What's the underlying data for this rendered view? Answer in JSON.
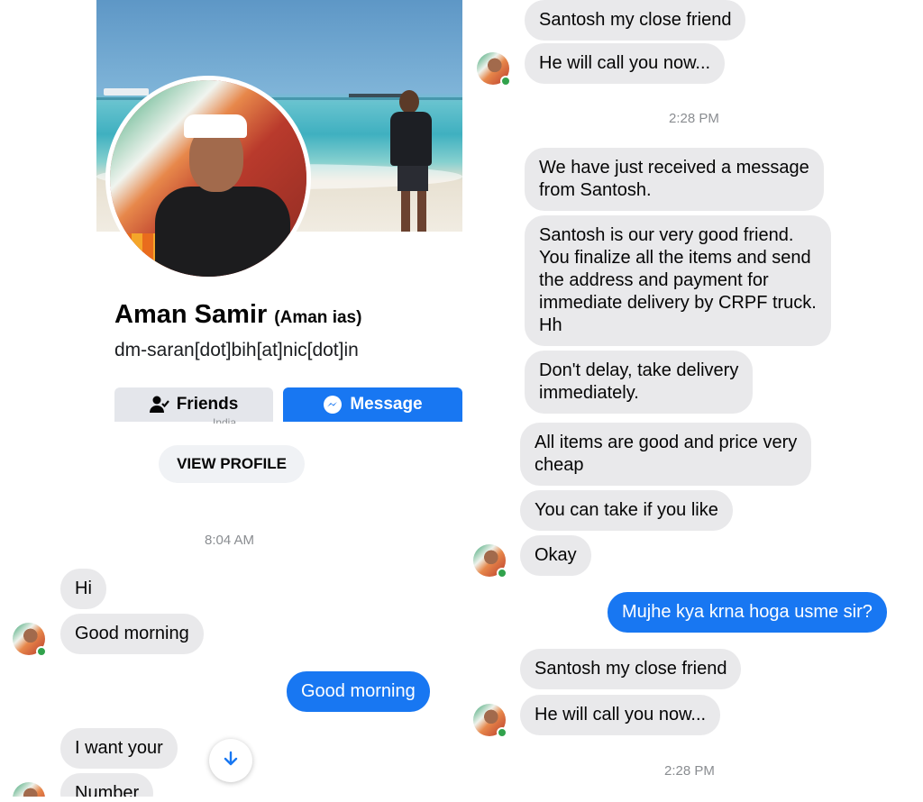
{
  "left": {
    "profile": {
      "name": "Aman Samir",
      "nickname": "(Aman ias)",
      "email": "dm-saran[dot]bih[at]nic[dot]in",
      "location_partial": "India",
      "friends_button": "Friends",
      "message_button": "Message",
      "view_profile_button": "VIEW PROFILE"
    },
    "messages": {
      "time1": "8:04 AM",
      "m1": "Hi",
      "m2": "Good morning",
      "m3": "Good morning",
      "m4": "I want your",
      "m5": "Number"
    }
  },
  "right": {
    "m1": "Santosh my close friend",
    "m2": "He will call you now...",
    "time1": "2:28 PM",
    "m3": "We have just received a message\nfrom Santosh.",
    "m4": "Santosh is our very good friend.\nYou finalize all the items and send\nthe address and payment for\nimmediate delivery by CRPF truck.\nHh",
    "m5": "Don't delay, take delivery\nimmediately.",
    "m6": "All items are good and price very\ncheap",
    "m7": "You can take if you like",
    "m8": "Okay",
    "m9": "Mujhe kya krna hoga usme sir?",
    "m10": "Santosh my close friend",
    "m11": "He will call you now...",
    "time2": "2:28 PM"
  },
  "colors": {
    "accent": "#1877f2",
    "bubble_incoming": "#e9e9eb",
    "online": "#31a24c"
  },
  "icons": [
    "friends-icon",
    "messenger-icon",
    "arrow-down-icon"
  ]
}
